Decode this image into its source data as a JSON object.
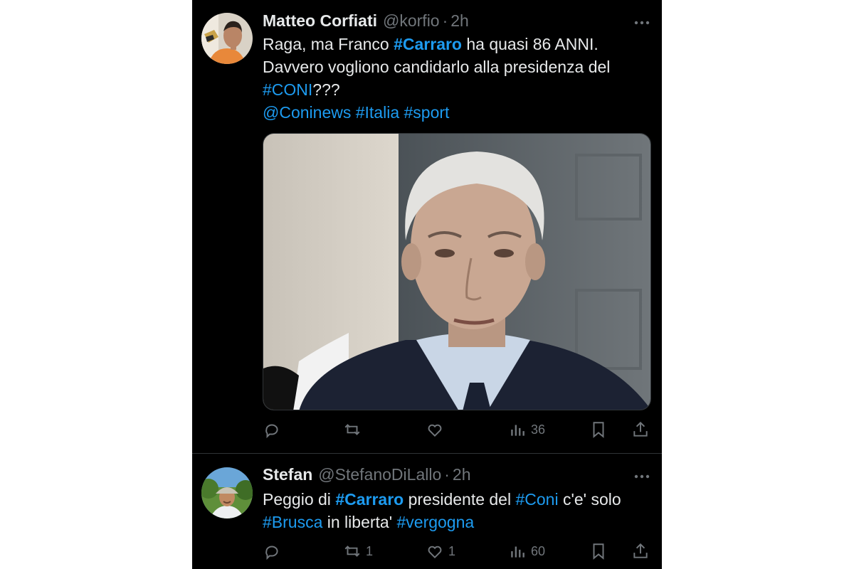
{
  "tweets": [
    {
      "name": "Matteo Corfiati",
      "handle": "@korfio",
      "separator": "·",
      "time": "2h",
      "text_lines": [
        [
          {
            "t": "Raga, ma Franco "
          },
          {
            "t": "#Carraro",
            "link": true,
            "strong": true
          },
          {
            "t": " ha quasi 86 ANNI."
          }
        ],
        [
          {
            "t": "Davvero vogliono candidarlo alla presidenza del"
          }
        ],
        [
          {
            "t": "#CONI",
            "link": true
          },
          {
            "t": "???"
          }
        ],
        [
          {
            "t": "@Coninews",
            "link": true
          },
          {
            "t": " "
          },
          {
            "t": "#Italia",
            "link": true
          },
          {
            "t": " "
          },
          {
            "t": "#sport",
            "link": true
          }
        ]
      ],
      "actions": {
        "reply": "",
        "repost": "",
        "like": "",
        "views": "36"
      }
    },
    {
      "name": "Stefan",
      "handle": "@StefanoDiLallo",
      "separator": "·",
      "time": "2h",
      "text_lines": [
        [
          {
            "t": "Peggio di "
          },
          {
            "t": "#Carraro",
            "link": true,
            "strong": true
          },
          {
            "t": " presidente del "
          },
          {
            "t": "#Coni",
            "link": true
          },
          {
            "t": " c'e' solo"
          }
        ],
        [
          {
            "t": "#Brusca",
            "link": true
          },
          {
            "t": " in liberta' "
          },
          {
            "t": "#vergogna",
            "link": true
          }
        ]
      ],
      "actions": {
        "reply": "",
        "repost": "1",
        "like": "1",
        "views": "60"
      }
    }
  ],
  "colors": {
    "background": "#000000",
    "text": "#e7e9ea",
    "muted": "#71767b",
    "link": "#1d9bf0",
    "divider": "#2f3336"
  },
  "icons": [
    "more-icon",
    "reply-icon",
    "repost-icon",
    "like-icon",
    "views-icon",
    "bookmark-icon",
    "share-icon"
  ]
}
